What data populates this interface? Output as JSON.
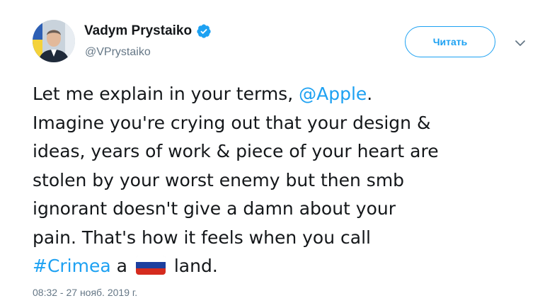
{
  "author": {
    "display_name": "Vadym Prystaiko",
    "handle": "@VPrystaiko",
    "verified": true
  },
  "actions": {
    "follow_label": "Читать"
  },
  "tweet": {
    "lines": [
      {
        "pre": "Let me explain in your terms, ",
        "mention": "@Apple",
        "post": "."
      },
      {
        "text": "Imagine you're crying out that your design &"
      },
      {
        "text": "ideas, years of work & piece of your heart are"
      },
      {
        "text": "stolen by your worst enemy but then smb"
      },
      {
        "text": "ignorant doesn't give a damn about your"
      },
      {
        "text": "pain. That's how it feels when you call"
      },
      {
        "hashtag": "#Crimea",
        "mid": " a ",
        "emoji": "russia-flag-icon",
        "post": " land."
      }
    ]
  },
  "timestamp": "08:32 - 27 нояб. 2019 г.",
  "colors": {
    "link": "#1da1f2",
    "text": "#14171a",
    "secondary": "#657786"
  }
}
